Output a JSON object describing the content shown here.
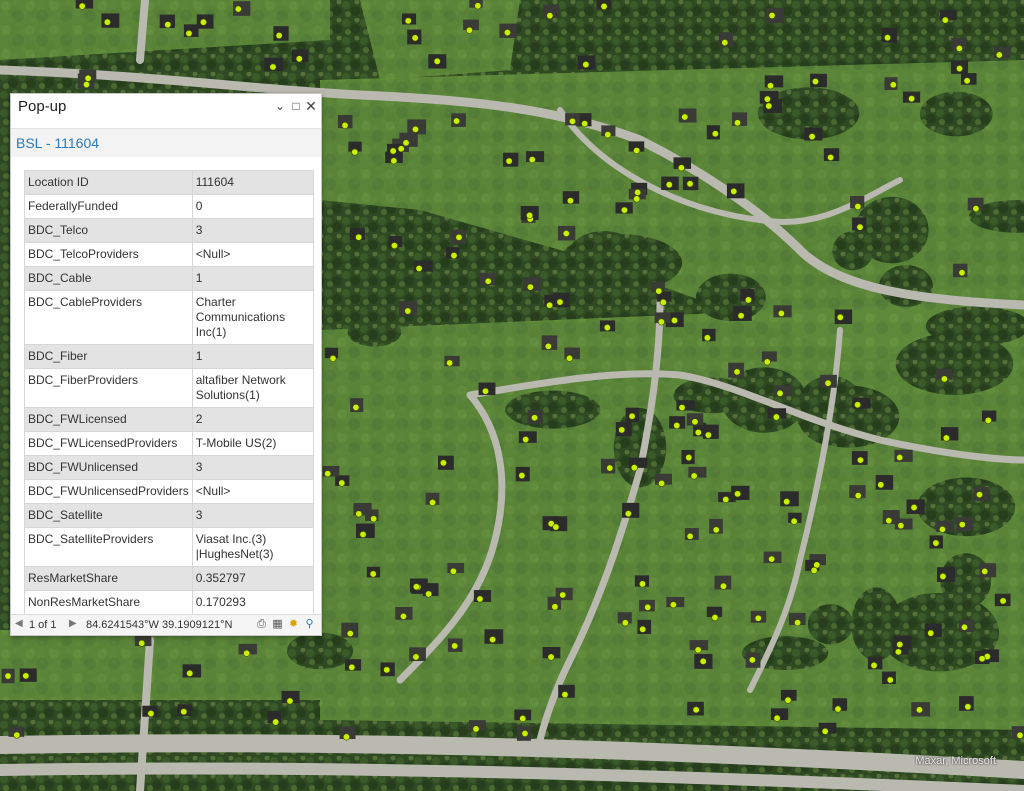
{
  "map": {
    "attribution": "Maxar, Microsoft",
    "point_color": "#c8f000",
    "road_color": "#b9b9b0",
    "grass_color": "#5f8a3a",
    "forest_color": "#2f4a22"
  },
  "popup": {
    "title": "Pop-up",
    "feature_title": "BSL - 111604",
    "rows": [
      {
        "field": "Location ID",
        "value": "111604"
      },
      {
        "field": "FederallyFunded",
        "value": "0"
      },
      {
        "field": "BDC_Telco",
        "value": "3"
      },
      {
        "field": "BDC_TelcoProviders",
        "value": "<Null>"
      },
      {
        "field": "BDC_Cable",
        "value": "1"
      },
      {
        "field": "BDC_CableProviders",
        "value": "Charter Communications Inc(1)"
      },
      {
        "field": "BDC_Fiber",
        "value": "1"
      },
      {
        "field": "BDC_FiberProviders",
        "value": "altafiber Network Solutions(1)"
      },
      {
        "field": "BDC_FWLicensed",
        "value": "2"
      },
      {
        "field": "BDC_FWLicensedProviders",
        "value": "T-Mobile US(2)"
      },
      {
        "field": "BDC_FWUnlicensed",
        "value": "3"
      },
      {
        "field": "BDC_FWUnlicensedProviders",
        "value": "<Null>"
      },
      {
        "field": "BDC_Satellite",
        "value": "3"
      },
      {
        "field": "BDC_SatelliteProviders",
        "value": "Viasat Inc.(3) |HughesNet(3)"
      },
      {
        "field": "ResMarketShare",
        "value": "0.352797"
      },
      {
        "field": "NonResMarketShare",
        "value": "0.170293"
      }
    ],
    "footer": {
      "pager": "1 of 1",
      "coordinates": "84.6241543°W 39.1909121°N"
    }
  }
}
